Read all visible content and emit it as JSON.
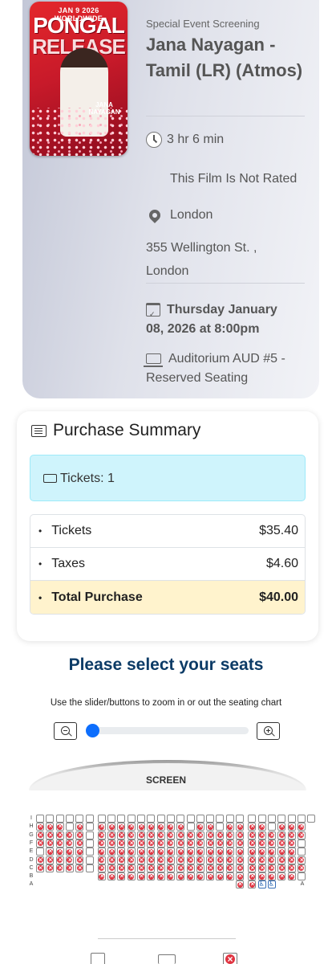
{
  "event": {
    "poster_date_text": "JAN 9 2026 WORLDWIDE",
    "poster_title_line1": "PONGAL",
    "poster_title_line2": "RELEASE",
    "poster_logo_text": "JANA NAYAGAN",
    "type_label": "Special Event Screening",
    "title": "Jana Nayagan - Tamil (LR) (Atmos)",
    "duration": "3 hr 6 min",
    "rating": "This Film Is Not Rated",
    "city": "London",
    "address": "355 Wellington St. , London",
    "datetime": "Thursday January 08, 2026 at 8:00pm",
    "auditorium": "Auditorium AUD #5 - Reserved Seating"
  },
  "summary": {
    "heading": "Purchase Summary",
    "tickets_count": "Tickets: 1",
    "lines": [
      {
        "label": "Tickets",
        "amount": "$35.40"
      },
      {
        "label": "Taxes",
        "amount": "$4.60"
      },
      {
        "label": "Total Purchase",
        "amount": "$40.00"
      }
    ]
  },
  "seating": {
    "heading": "Please select your seats",
    "hint": "Use the slider/buttons to zoom in or out the seating chart",
    "zoom_level": 0,
    "screen_label": "SCREEN",
    "rows": [
      {
        "label": "I",
        "seats": "...........................o"
      },
      {
        "label": "H",
        "seats": "xxx.x.xxxxxxxxx.xx.xxxx.xxx"
      },
      {
        "label": "G",
        "seats": "xxxxx.xxxxxxxxxxxxxxxxxxxxx"
      },
      {
        "label": "F",
        "seats": "xxxxx.xxxxxxxxxxxxxxxxxxxx."
      },
      {
        "label": "E",
        "seats": ".xxxx.xxxxxxxxxxxxxxxxxxxx."
      },
      {
        "label": "D",
        "seats": "xxxxx.xxxxxxxxxxxxxxxxxxxxx"
      },
      {
        "label": "C",
        "seats": "xxxxx.xxxxxxxxxxxxxxxxxxxxx"
      },
      {
        "label": "B",
        "seats": "......xxxxxxxxxxxxxxxxxxxx."
      },
      {
        "label": "A",
        "seats": "....................xxaa..."
      }
    ],
    "legend": [
      "available",
      "selected",
      "taken"
    ]
  }
}
